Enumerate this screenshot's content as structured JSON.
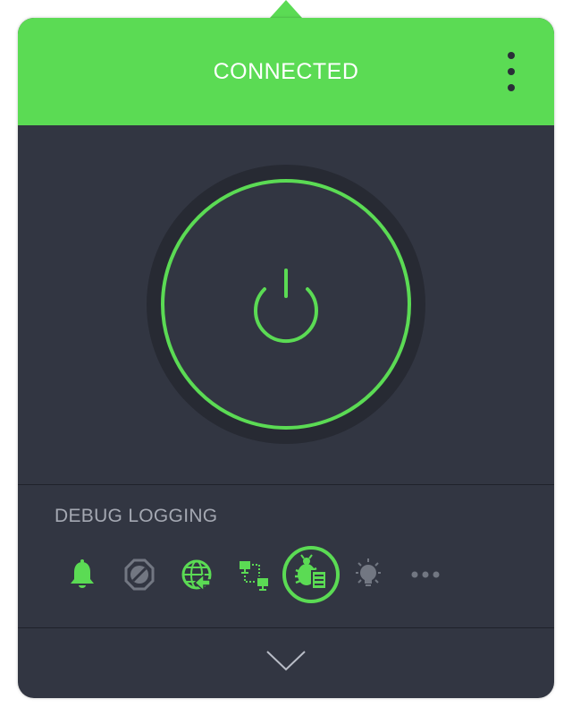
{
  "header": {
    "status": "CONNECTED",
    "menu_icon": "vertical-ellipsis-icon"
  },
  "power": {
    "icon": "power-icon",
    "state": "on"
  },
  "settings_section": {
    "title": "DEBUG LOGGING",
    "tools": [
      {
        "name": "notifications",
        "icon": "bell-icon",
        "state": "enabled"
      },
      {
        "name": "ad-blocker",
        "icon": "block-icon",
        "state": "disabled"
      },
      {
        "name": "network",
        "icon": "globe-icon",
        "state": "enabled"
      },
      {
        "name": "local-network",
        "icon": "lan-icon",
        "state": "enabled"
      },
      {
        "name": "debug-logging",
        "icon": "bug-log-icon",
        "state": "selected"
      },
      {
        "name": "tips",
        "icon": "lightbulb-icon",
        "state": "disabled"
      },
      {
        "name": "more",
        "icon": "ellipsis-icon",
        "state": "disabled"
      }
    ]
  },
  "footer": {
    "expand_icon": "chevron-down-icon"
  },
  "colors": {
    "accent": "#5bdb54",
    "panel_background": "#323642",
    "power_ring_background": "#272a33",
    "muted_text": "#a4a8b2",
    "inactive_icon": "#727782"
  }
}
